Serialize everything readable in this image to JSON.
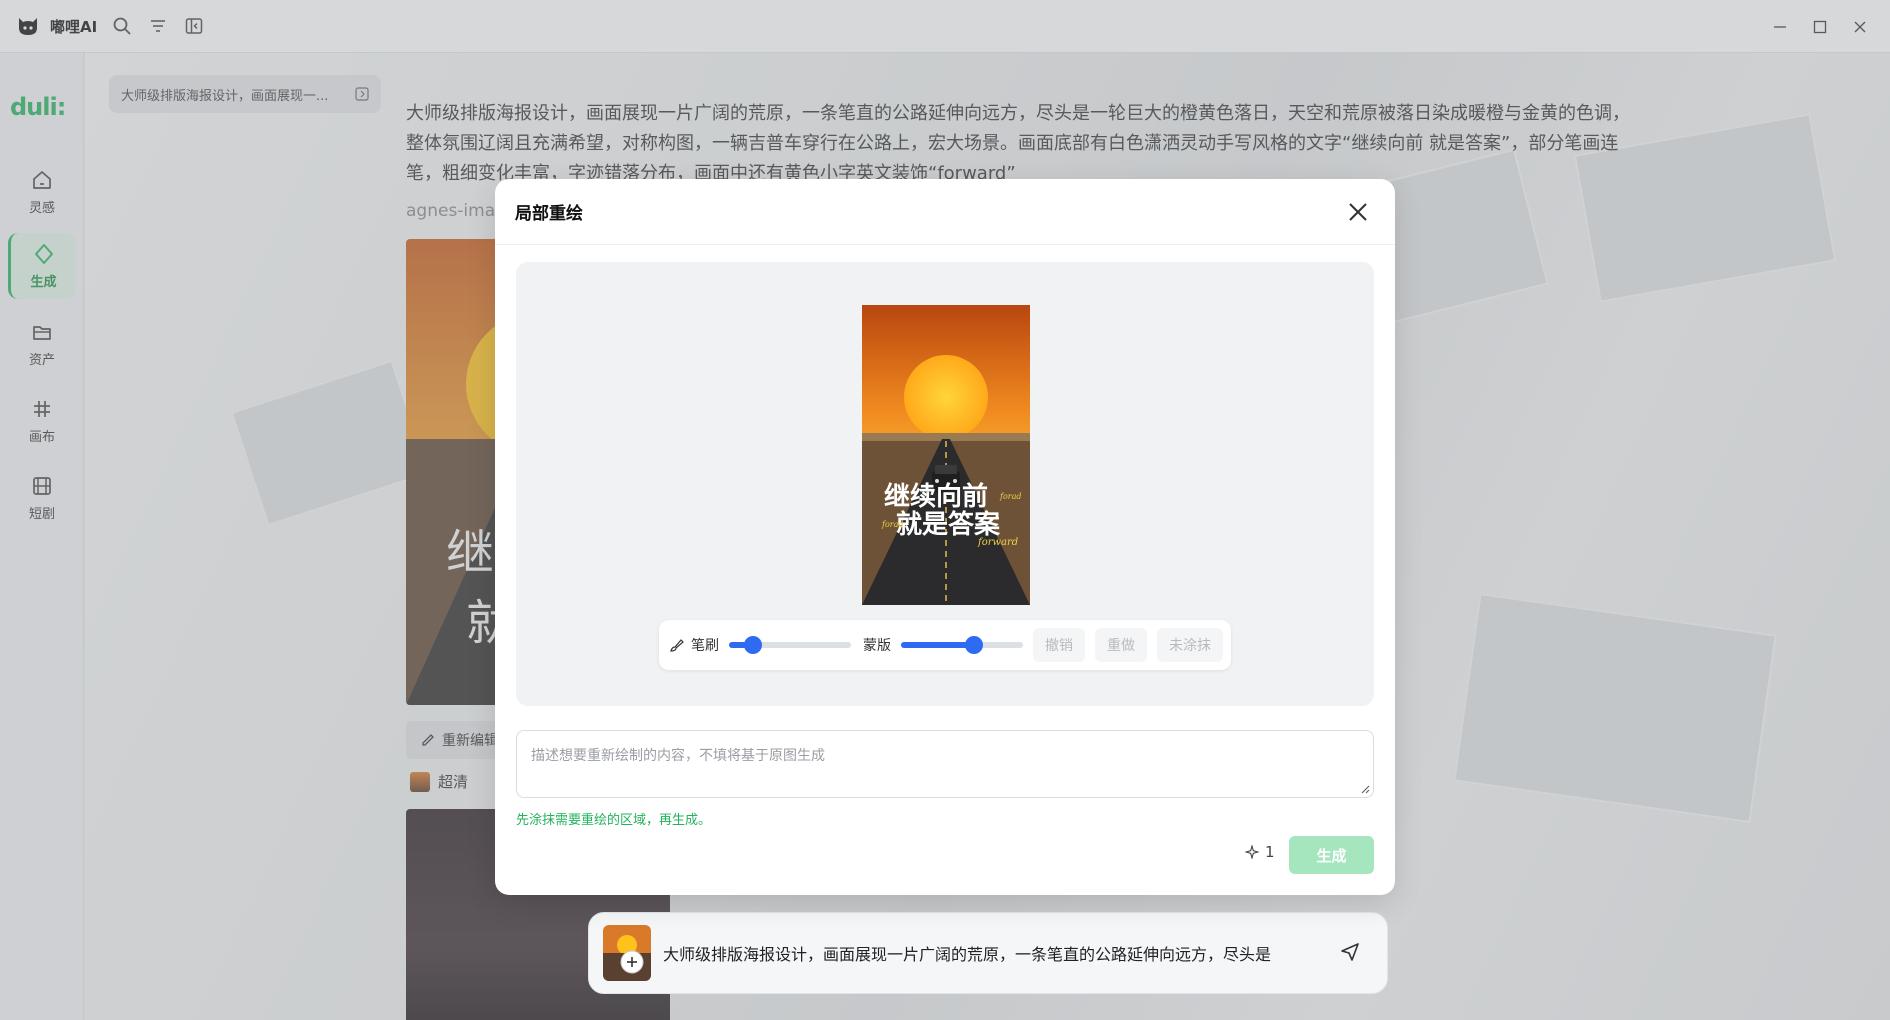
{
  "app": {
    "title": "嘟哩AI"
  },
  "sidebar": {
    "brand": "duli:",
    "items": [
      {
        "label": "灵感",
        "icon": "home-icon"
      },
      {
        "label": "生成",
        "icon": "sparkle-icon",
        "active": true
      },
      {
        "label": "资产",
        "icon": "folder-icon"
      },
      {
        "label": "画布",
        "icon": "grid-icon"
      },
      {
        "label": "短剧",
        "icon": "film-icon"
      }
    ]
  },
  "main": {
    "chip": "大师级排版海报设计，画面展现一...",
    "prompt": "大师级排版海报设计，画面展现一片广阔的荒原，一条笔直的公路延伸向远方，尽头是一轮巨大的橙黄色落日，天空和荒原被落日染成暖橙与金黄的色调，整体氛围辽阔且充满希望，对称构图，一辆吉普车穿行在公路上，宏大场景。画面底部有白色潇洒灵动手写风格的文字“继续向前 就是答案”，部分笔画连笔，粗细变化丰富，字迹错落分布，画面中还有黄色小字英文装饰“forward”",
    "model": "agnes-ima",
    "edit_button": "重新编辑",
    "quality": "超清",
    "input_text": "大师级排版海报设计，画面展现一片广阔的荒原，一条笔直的公路延伸向远方，尽头是"
  },
  "modal": {
    "title": "局部重绘",
    "poster": {
      "line1": "继续向前",
      "line2": "就是答案",
      "small1": "forad",
      "small2": "forad",
      "small3": "forward"
    },
    "toolbar": {
      "brush_label": "笔刷",
      "brush_value": 0.2,
      "mask_label": "蒙版",
      "mask_value": 0.6,
      "undo": "撤销",
      "redo": "重做",
      "clear": "未涂抹"
    },
    "placeholder": "描述想要重新绘制的内容，不填将基于原图生成",
    "hint": "先涂抹需要重绘的区域，再生成。",
    "credit": "1",
    "generate": "生成"
  },
  "colors": {
    "accent": "#22b45c",
    "slider": "#2f6bf2",
    "generate_disabled": "#a6e6bf"
  }
}
